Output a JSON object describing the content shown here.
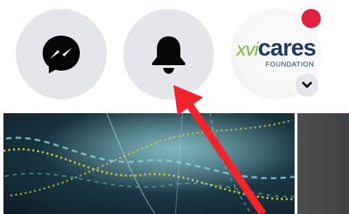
{
  "topbar": {
    "messenger": {
      "icon": "messenger-icon"
    },
    "notifications": {
      "icon": "bell-icon"
    },
    "profile": {
      "logo_main_left": "xvi",
      "logo_main_right": "cares",
      "logo_sub": "FOUNDATION",
      "has_unread_dot": true,
      "menu_icon": "chevron-down-icon"
    }
  },
  "content": {
    "hero_image": "abstract teal light streaks with yellow dotted curves"
  },
  "annotation": {
    "type": "red-arrow",
    "points_to": "bell-button"
  },
  "colors": {
    "button_bg": "#e5e6eb",
    "icon": "#050505",
    "notification_dot": "#e41e3f",
    "logo_green": "#7cba3b",
    "logo_navy": "#1d3c73",
    "arrow_red": "#f2242b"
  }
}
